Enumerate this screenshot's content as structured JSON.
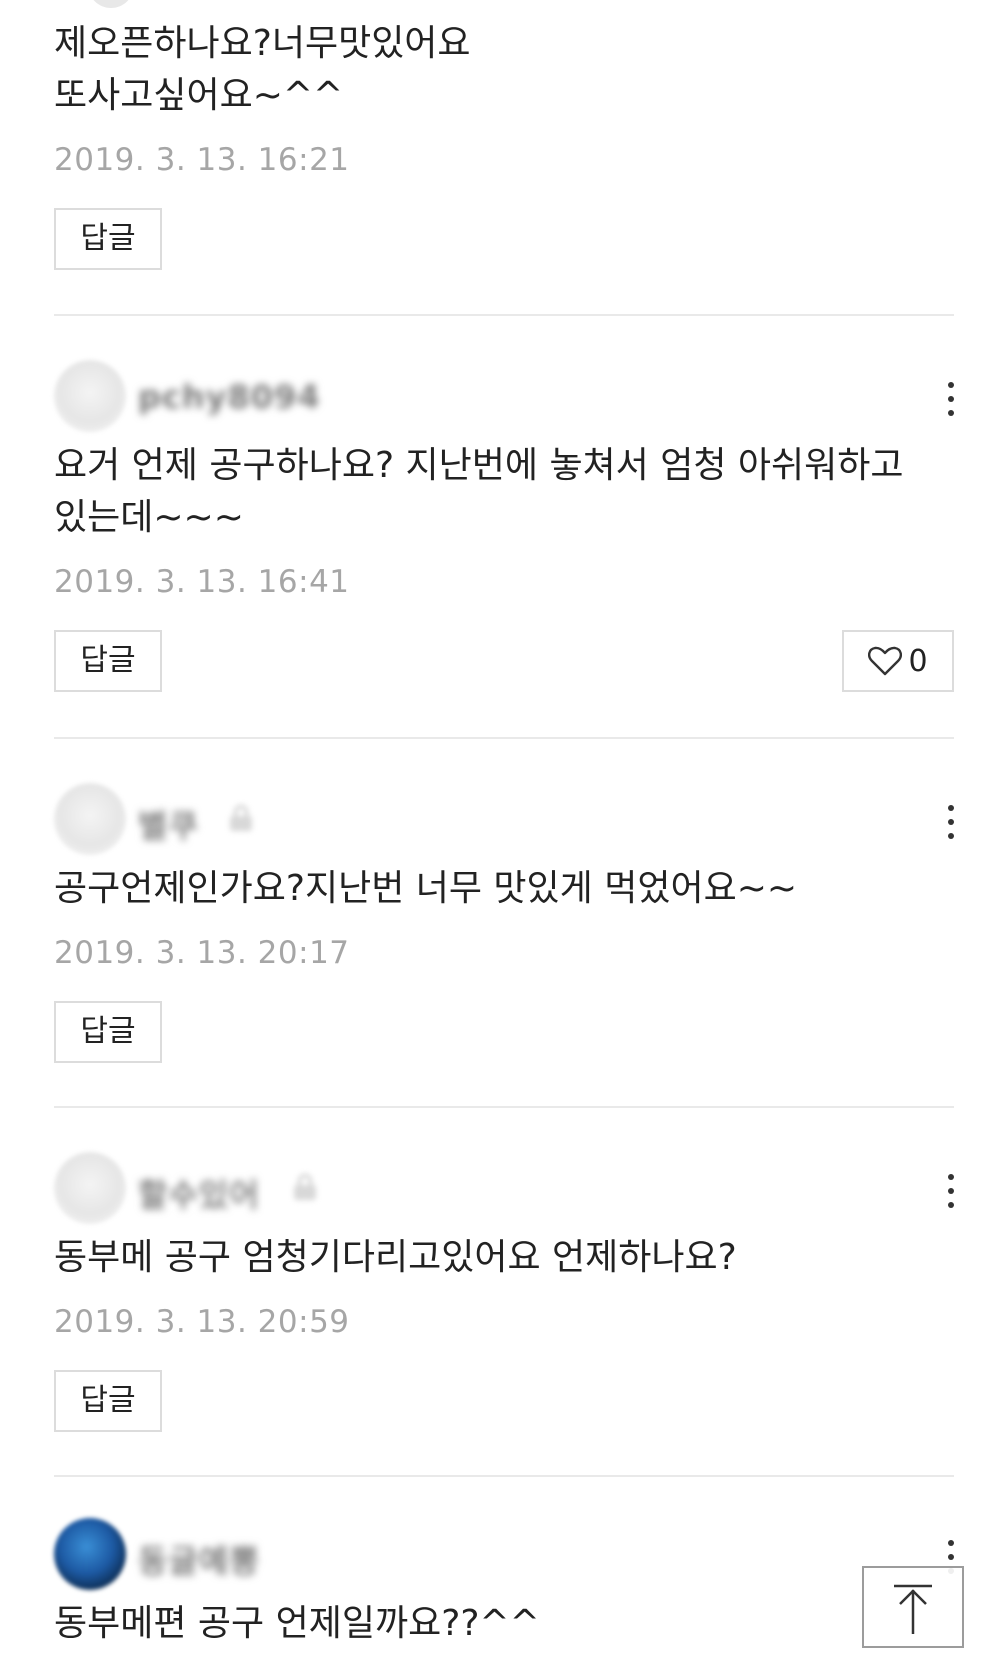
{
  "comments": [
    {
      "text": "제오픈하나요?너무맛있어요\n또사고싶어요~^^",
      "timestamp": "2019. 3. 13. 16:21",
      "reply_label": "답글"
    },
    {
      "nickname": "pchy8094",
      "text": "요거 언제 공구하나요? 지난번에 놓쳐서 엄청 아쉬워하고\n있는데~~~",
      "timestamp": "2019. 3. 13. 16:41",
      "reply_label": "답글",
      "like_count": "0"
    },
    {
      "nickname": "별쿠",
      "text": "공구언제인가요?지난번 너무 맛있게 먹었어요~~",
      "timestamp": "2019. 3. 13. 20:17",
      "reply_label": "답글"
    },
    {
      "nickname": "할수있어",
      "text": "동부메 공구 엄청기다리고있어요 언제하나요?",
      "timestamp": "2019. 3. 13. 20:59",
      "reply_label": "답글"
    },
    {
      "nickname": "동글예뽕",
      "text": "동부메편 공구 언제일까요??^^"
    }
  ]
}
